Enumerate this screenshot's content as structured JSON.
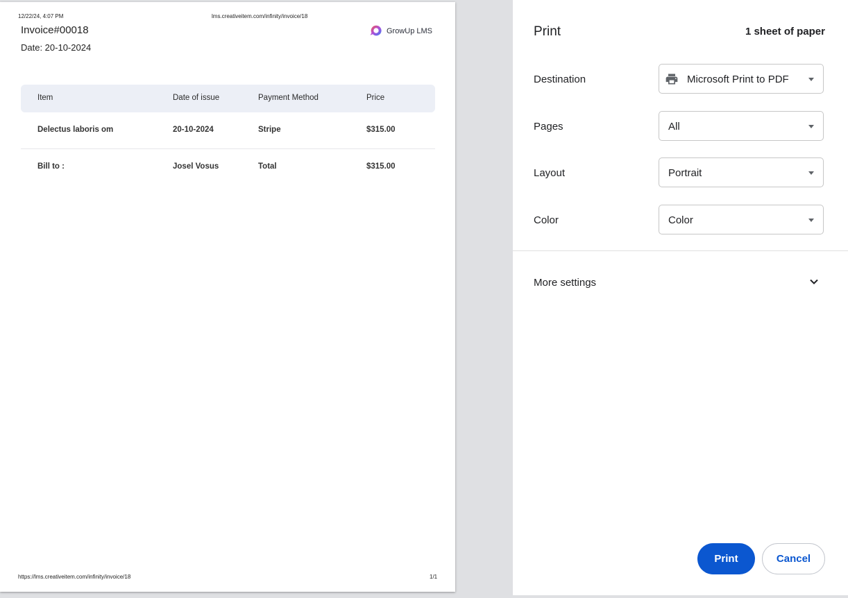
{
  "preview": {
    "header_datetime": "12/22/24, 4:07 PM",
    "header_url": "lms.creativeitem.com/infinity/invoice/18",
    "footer_url": "https://lms.creativeitem.com/infinity/invoice/18",
    "footer_page": "1/1",
    "invoice": {
      "title": "Invoice#00018",
      "date": "Date: 20-10-2024",
      "brand": "GrowUp LMS",
      "columns": [
        "Item",
        "Date of issue",
        "Payment Method",
        "Price"
      ],
      "rows": [
        [
          "Delectus laboris om",
          "20-10-2024",
          "Stripe",
          "$315.00"
        ],
        [
          "Bill to :",
          "Josel Vosus",
          "Total",
          "$315.00"
        ]
      ]
    }
  },
  "dialog": {
    "title": "Print",
    "sheet_count": "1 sheet of paper",
    "settings": [
      {
        "label": "Destination",
        "value": "Microsoft Print to PDF",
        "icon": "printer-icon"
      },
      {
        "label": "Pages",
        "value": "All"
      },
      {
        "label": "Layout",
        "value": "Portrait"
      },
      {
        "label": "Color",
        "value": "Color"
      }
    ],
    "more_settings": "More settings",
    "print_label": "Print",
    "cancel_label": "Cancel",
    "accent_color": "#0b57d0"
  }
}
